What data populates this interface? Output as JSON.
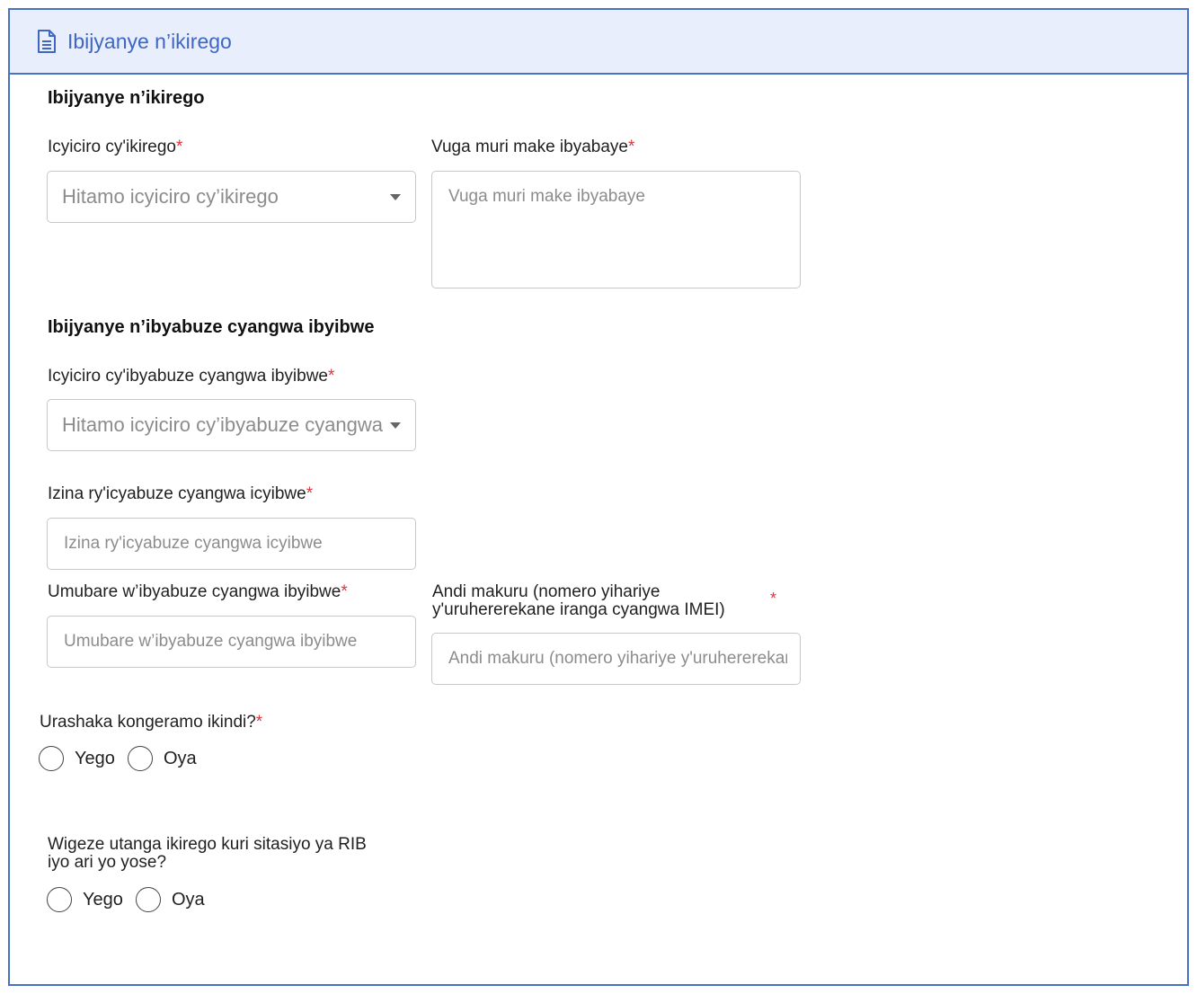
{
  "header": {
    "title": "Ibijyanye n’ikirego",
    "icon": "document-icon"
  },
  "sections": {
    "complaint": "Ibijyanye n’ikirego",
    "lost_items": "Ibijyanye n’ibyabuze cyangwa ibyibwe"
  },
  "required_mark": "*",
  "fields": {
    "complaint_type": {
      "label": "Icyiciro cy'ikirego",
      "placeholder": "Hitamo icyiciro cy’ikirego"
    },
    "description": {
      "label": "Vuga muri make ibyabaye",
      "placeholder": "Vuga muri make ibyabaye"
    },
    "item_type": {
      "label": "Icyiciro cy'ibyabuze cyangwa ibyibwe",
      "placeholder": "Hitamo icyiciro cy’ibyabuze cyangwa ibyibwe"
    },
    "item_name": {
      "label": "Izina ry'icyabuze cyangwa icyibwe",
      "placeholder": "Izina ry'icyabuze cyangwa icyibwe"
    },
    "item_count": {
      "label": "Umubare w’ibyabuze cyangwa ibyibwe",
      "placeholder": "Umubare w’ibyabuze cyangwa ibyibwe"
    },
    "other_info": {
      "label_line1": "Andi makuru (nomero yihariye",
      "label_line2": "y'uruhererekane iranga cyangwa IMEI)",
      "placeholder": "Andi makuru (nomero yihariye y'uruhererekane iranga cyangwa IMEI)"
    }
  },
  "questions": {
    "add_more": {
      "label": "Urashaka kongeramo ikindi?",
      "yes": "Yego",
      "no": "Oya"
    },
    "rib_station": {
      "label_line1": "Wigeze utanga ikirego kuri sitasiyo ya RIB",
      "label_line2": "iyo ari yo yose?",
      "yes": "Yego",
      "no": "Oya"
    }
  }
}
